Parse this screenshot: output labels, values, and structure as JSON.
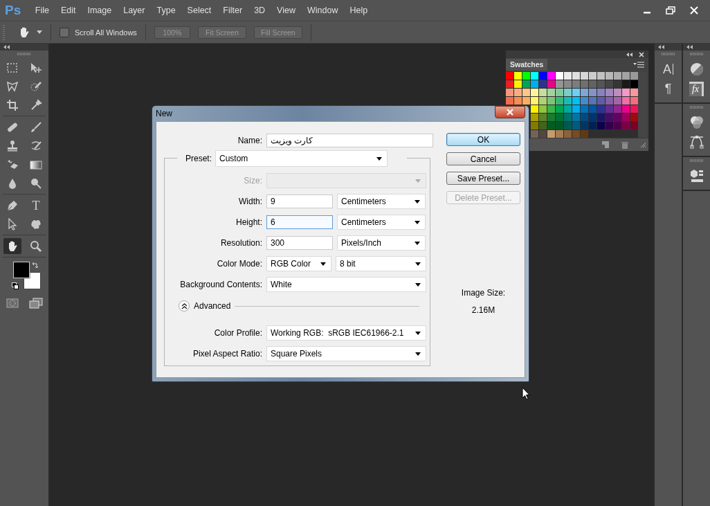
{
  "app": {
    "logo": "Ps"
  },
  "menu": [
    "File",
    "Edit",
    "Image",
    "Layer",
    "Type",
    "Select",
    "Filter",
    "3D",
    "View",
    "Window",
    "Help"
  ],
  "options_bar": {
    "scroll_all": {
      "label": "Scroll All Windows",
      "checked": false
    },
    "buttons": [
      "100%",
      "Fit Screen",
      "Fill Screen"
    ]
  },
  "tool_groups": [
    [
      {
        "kind": "marquee",
        "selected": false
      },
      {
        "kind": "move",
        "selected": false
      },
      {
        "kind": "lasso",
        "selected": false
      },
      {
        "kind": "quick-select",
        "selected": false
      },
      {
        "kind": "crop",
        "selected": false
      },
      {
        "kind": "eyedropper",
        "selected": false
      }
    ],
    [
      {
        "kind": "healing",
        "selected": false
      },
      {
        "kind": "brush",
        "selected": false
      },
      {
        "kind": "stamp",
        "selected": false
      },
      {
        "kind": "history-brush",
        "selected": false
      },
      {
        "kind": "eraser",
        "selected": false
      },
      {
        "kind": "gradient",
        "selected": false
      },
      {
        "kind": "blur",
        "selected": false
      },
      {
        "kind": "dodge",
        "selected": false
      }
    ],
    [
      {
        "kind": "pen",
        "selected": false
      },
      {
        "kind": "type",
        "selected": false,
        "glyph": "T"
      },
      {
        "kind": "path-select",
        "selected": false
      },
      {
        "kind": "shape",
        "selected": false
      }
    ],
    [
      {
        "kind": "hand",
        "selected": true
      },
      {
        "kind": "zoom",
        "selected": false
      }
    ]
  ],
  "colors": {
    "foreground": {
      "color": "#000000"
    },
    "background": {
      "color": "#ffffff"
    }
  },
  "swatches": {
    "title": "Swatches",
    "rows": [
      [
        {
          "color": "#ff0000"
        },
        {
          "color": "#ffff00"
        },
        {
          "color": "#00ff00"
        },
        {
          "color": "#00ffff"
        },
        {
          "color": "#0000ff"
        },
        {
          "color": "#ff00ff"
        },
        {
          "color": "#ffffff"
        },
        {
          "color": "#ebebeb"
        },
        {
          "color": "#e0e0e0"
        },
        {
          "color": "#d6d6d6"
        },
        {
          "color": "#cccccc"
        },
        {
          "color": "#c2c2c2"
        },
        {
          "color": "#b8b8b8"
        },
        {
          "color": "#adadad"
        },
        {
          "color": "#a3a3a3"
        },
        {
          "color": "#999999"
        }
      ],
      [
        {
          "color": "#ed1c24"
        },
        {
          "color": "#fff200"
        },
        {
          "color": "#00a651"
        },
        {
          "color": "#00aeef"
        },
        {
          "color": "#2e3192"
        },
        {
          "color": "#ec008c"
        },
        {
          "color": "#959595"
        },
        {
          "color": "#898989"
        },
        {
          "color": "#7d7d7d"
        },
        {
          "color": "#707070"
        },
        {
          "color": "#626262"
        },
        {
          "color": "#555555"
        },
        {
          "color": "#464646"
        },
        {
          "color": "#363636"
        },
        {
          "color": "#1a1a1a"
        },
        {
          "color": "#000000"
        }
      ],
      [
        {
          "color": "#f7977a"
        },
        {
          "color": "#f9ad81"
        },
        {
          "color": "#fdc68a"
        },
        {
          "color": "#fff79a"
        },
        {
          "color": "#c4df9b"
        },
        {
          "color": "#a3d39c"
        },
        {
          "color": "#82ca9d"
        },
        {
          "color": "#7bcdc8"
        },
        {
          "color": "#6ecff6"
        },
        {
          "color": "#7ea7d8"
        },
        {
          "color": "#8493ca"
        },
        {
          "color": "#8882be"
        },
        {
          "color": "#a187be"
        },
        {
          "color": "#bc8dbf"
        },
        {
          "color": "#f49ac2"
        },
        {
          "color": "#f6989d"
        }
      ],
      [
        {
          "color": "#f26c4f"
        },
        {
          "color": "#f68e55"
        },
        {
          "color": "#fbaf5c"
        },
        {
          "color": "#fff467"
        },
        {
          "color": "#acd372"
        },
        {
          "color": "#7cc576"
        },
        {
          "color": "#3bb878"
        },
        {
          "color": "#1abbb4"
        },
        {
          "color": "#00bff3"
        },
        {
          "color": "#438ccb"
        },
        {
          "color": "#5574b9"
        },
        {
          "color": "#605ca8"
        },
        {
          "color": "#855fa8"
        },
        {
          "color": "#a763a8"
        },
        {
          "color": "#f06eaa"
        },
        {
          "color": "#f26d7d"
        }
      ],
      [
        null,
        null,
        null,
        {
          "color": "#fff200"
        },
        {
          "color": "#8dc73f"
        },
        {
          "color": "#39b54a"
        },
        {
          "color": "#00a651"
        },
        {
          "color": "#00a99d"
        },
        {
          "color": "#00aeef"
        },
        {
          "color": "#0072bc"
        },
        {
          "color": "#0054a6"
        },
        {
          "color": "#2e3192"
        },
        {
          "color": "#662d91"
        },
        {
          "color": "#92278f"
        },
        {
          "color": "#ec008c"
        },
        {
          "color": "#ed145b"
        }
      ],
      [
        null,
        null,
        null,
        {
          "color": "#aba000"
        },
        {
          "color": "#598527"
        },
        {
          "color": "#1a7b30"
        },
        {
          "color": "#007236"
        },
        {
          "color": "#00746b"
        },
        {
          "color": "#0076a3"
        },
        {
          "color": "#004b80"
        },
        {
          "color": "#003471"
        },
        {
          "color": "#1b1464"
        },
        {
          "color": "#440e62"
        },
        {
          "color": "#630460"
        },
        {
          "color": "#9e005d"
        },
        {
          "color": "#9e0b0f"
        }
      ],
      [
        null,
        null,
        null,
        {
          "color": "#827b00"
        },
        {
          "color": "#406618"
        },
        {
          "color": "#005e20"
        },
        {
          "color": "#005826"
        },
        {
          "color": "#005952"
        },
        {
          "color": "#005b7f"
        },
        {
          "color": "#003663"
        },
        {
          "color": "#002157"
        },
        {
          "color": "#0d004c"
        },
        {
          "color": "#32004b"
        },
        {
          "color": "#4b0049"
        },
        {
          "color": "#7b0046"
        },
        {
          "color": "#7a0026"
        }
      ],
      [
        null,
        null,
        null,
        {
          "color": "#736357"
        },
        {
          "color": "#534741"
        },
        {
          "color": "#c69c6d"
        },
        {
          "color": "#a67c52"
        },
        {
          "color": "#8c6239"
        },
        {
          "color": "#754c24"
        },
        {
          "color": "#603913"
        }
      ]
    ]
  },
  "dock": [
    [
      [
        {
          "kind": "character",
          "glyph": "A"
        },
        {
          "kind": "paragraph",
          "glyph": "¶"
        }
      ]
    ],
    [
      [
        {
          "kind": "adjustments"
        },
        {
          "kind": "styles",
          "glyph": "fx"
        }
      ],
      [
        {
          "kind": "channels"
        },
        {
          "kind": "paths"
        }
      ],
      [
        {
          "kind": "properties"
        }
      ]
    ]
  ],
  "dialog": {
    "title": "New",
    "name": {
      "label": "Name:",
      "value": "کارت ویزیت"
    },
    "preset": {
      "label": "Preset:",
      "value": "Custom"
    },
    "rows": [
      {
        "kind": "select",
        "label": "Size:",
        "disabled": true,
        "focused": false
      },
      {
        "kind": "input",
        "label": "Width:",
        "value": "9",
        "unit": "Centimeters",
        "disabled": false,
        "focused": false
      },
      {
        "kind": "input",
        "label": "Height:",
        "value": "6",
        "unit": "Centimeters",
        "disabled": false,
        "focused": true
      },
      {
        "kind": "input",
        "label": "Resolution:",
        "value": "300",
        "unit": "Pixels/Inch",
        "disabled": false,
        "focused": false
      },
      {
        "kind": "select",
        "label": "Color Mode:",
        "value": "RGB Color",
        "unit": "8 bit",
        "disabled": false,
        "focused": false
      },
      {
        "kind": "select",
        "label": "Background Contents:",
        "value": "White",
        "disabled": false,
        "focused": false
      }
    ],
    "advanced": {
      "label": "Advanced",
      "expanded": true
    },
    "advanced_rows": [
      {
        "kind": "select",
        "label": "Color Profile:",
        "value": "Working RGB:  sRGB IEC61966-2.1",
        "disabled": false,
        "focused": false
      },
      {
        "kind": "select",
        "label": "Pixel Aspect Ratio:",
        "value": "Square Pixels",
        "disabled": false,
        "focused": false
      }
    ],
    "buttons": [
      {
        "label": "OK",
        "default": true,
        "disabled": false
      },
      {
        "label": "Cancel",
        "default": false,
        "disabled": false
      },
      {
        "label": "Save Preset...",
        "default": false,
        "disabled": false
      },
      {
        "label": "Delete Preset...",
        "default": false,
        "disabled": true
      }
    ],
    "image_size": {
      "label": "Image Size:",
      "value": "2.16M"
    }
  }
}
